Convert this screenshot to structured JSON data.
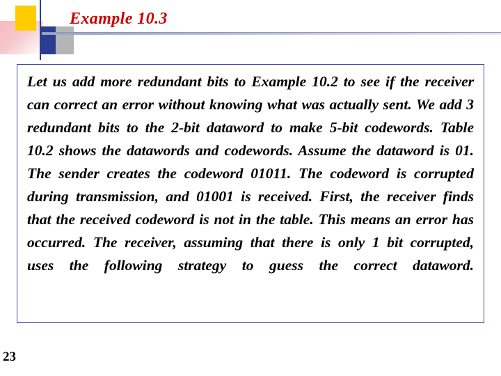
{
  "slide": {
    "title": "Example 10.3",
    "body": "Let us add more redundant bits to Example 10.2 to see if the receiver can correct an error without knowing what was actually sent. We add 3 redundant bits to the 2-bit dataword to make 5-bit codewords. Table 10.2 shows the datawords and codewords. Assume the dataword is 01. The sender creates the codeword 01011. The codeword is corrupted during transmission, and 01001 is received. First, the receiver finds that the received codeword is not in the table. This means an error has occurred. The receiver, assuming that there is only 1 bit corrupted, uses the following strategy to guess the correct dataword.",
    "page_number": "23",
    "colors": {
      "title": "#cc0000",
      "border": "#3a4aa0",
      "accent_yellow": "#ffcc00",
      "accent_blue": "#2b3d8f",
      "accent_pink": "#f8b8bd",
      "accent_gray": "#b5b5b5"
    }
  }
}
